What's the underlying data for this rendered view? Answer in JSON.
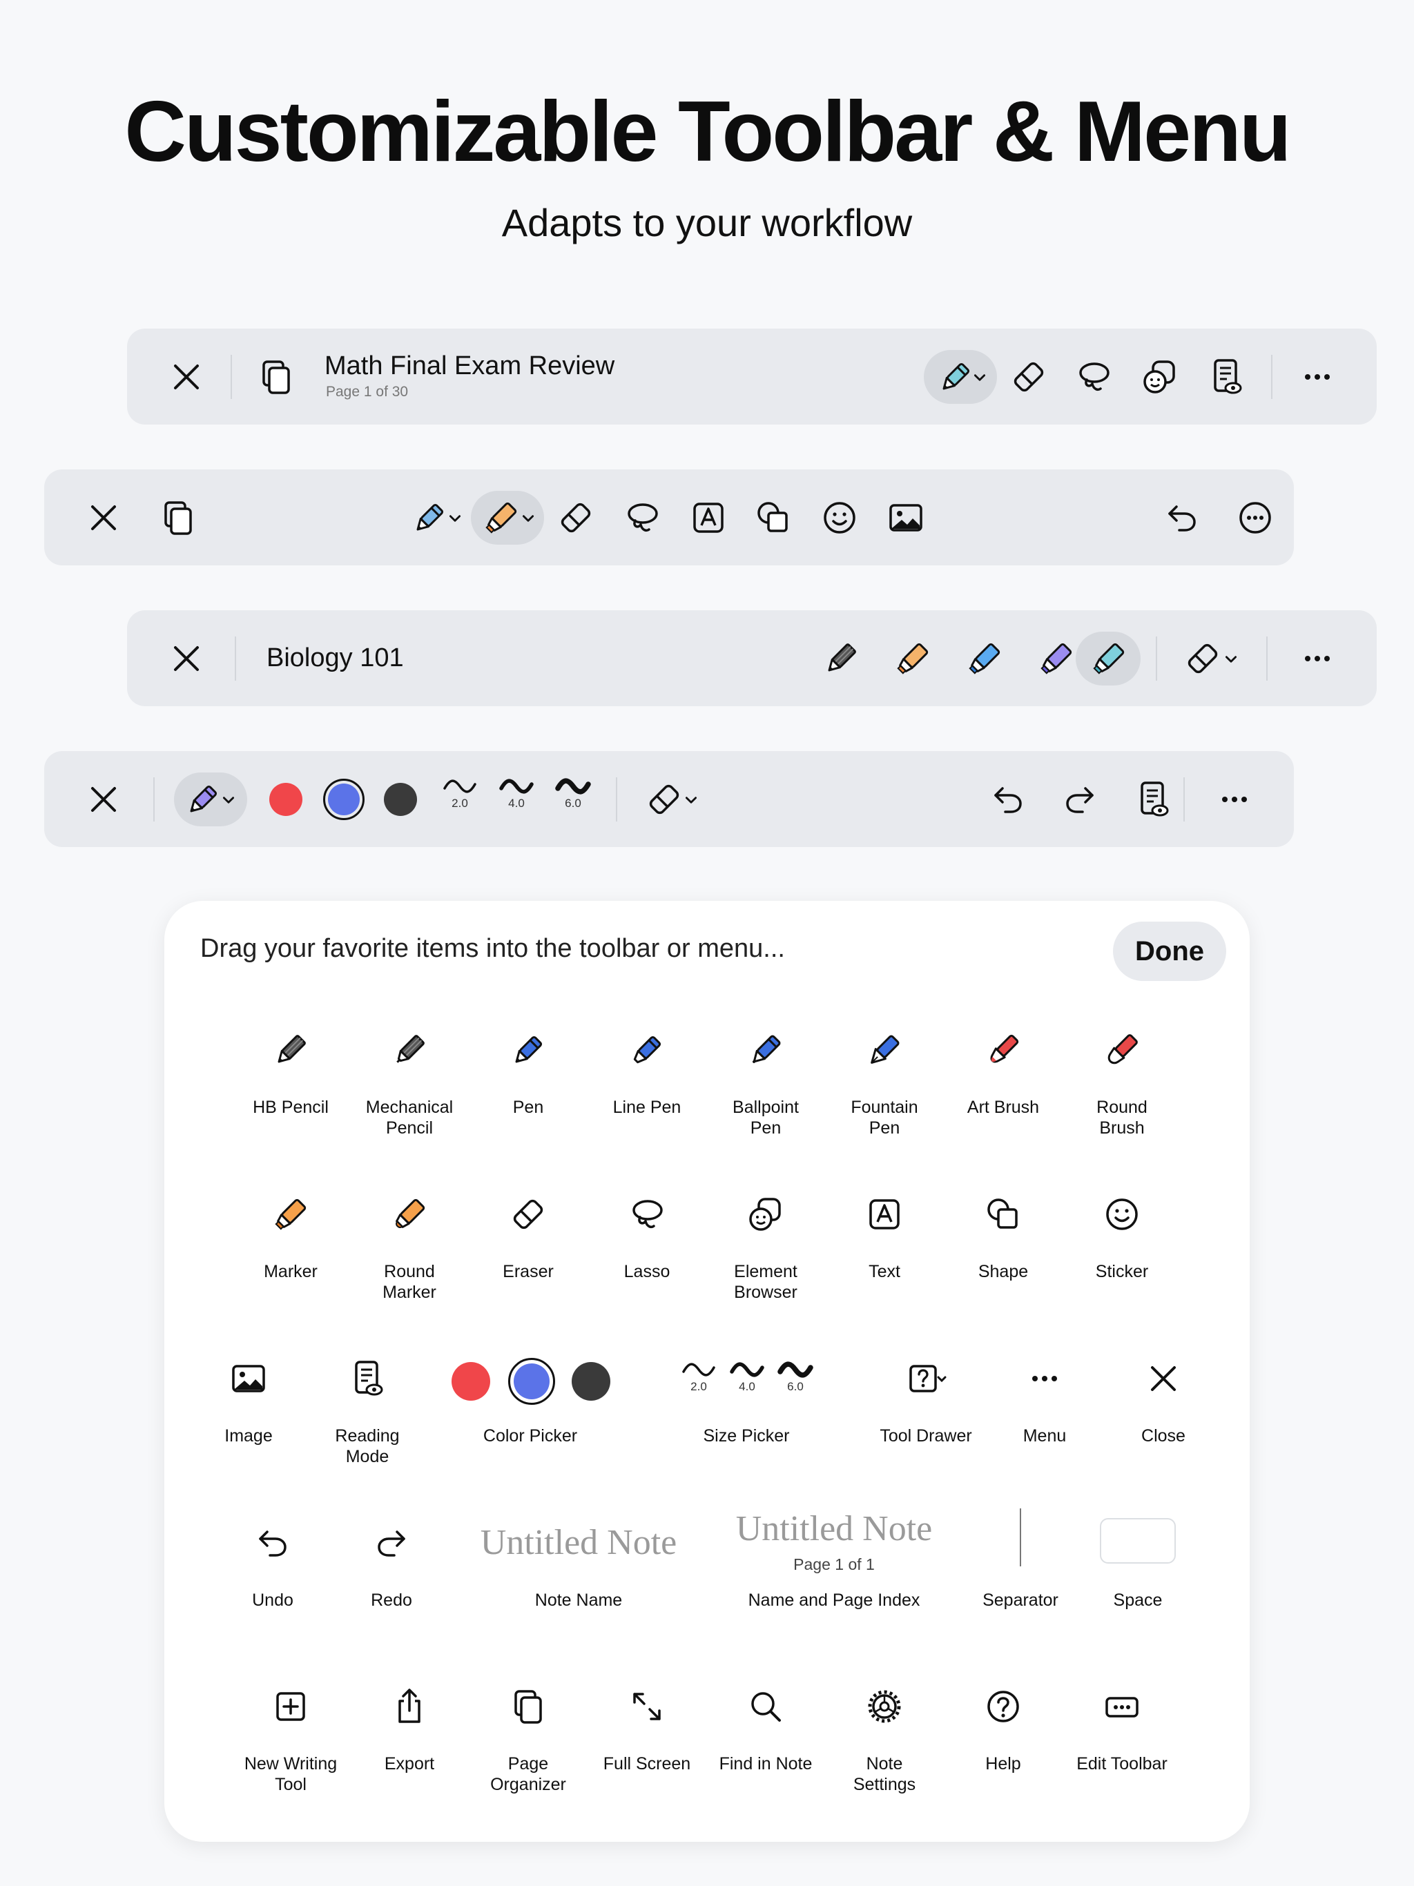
{
  "header": {
    "title": "Customizable Toolbar & Menu",
    "subtitle": "Adapts to your workflow"
  },
  "toolbar1": {
    "title": "Math Final Exam Review",
    "page_index": "Page 1 of 30"
  },
  "toolbar3": {
    "title": "Biology 101"
  },
  "toolbar4": {
    "colors": [
      "#f0464a",
      "#5b73e8",
      "#3a3a3a"
    ],
    "sizes": [
      "2.0",
      "4.0",
      "6.0"
    ]
  },
  "panel": {
    "hint": "Drag your favorite items into the toolbar or menu...",
    "done_label": "Done",
    "row1": [
      {
        "label": "HB Pencil",
        "icon": "pencil-dark-icon"
      },
      {
        "label": "Mechanical\nPencil",
        "icon": "mechanical-pencil-icon"
      },
      {
        "label": "Pen",
        "icon": "pen-icon"
      },
      {
        "label": "Line Pen",
        "icon": "line-pen-icon"
      },
      {
        "label": "Ballpoint\nPen",
        "icon": "ballpoint-pen-icon"
      },
      {
        "label": "Fountain\nPen",
        "icon": "fountain-pen-icon"
      },
      {
        "label": "Art Brush",
        "icon": "art-brush-icon"
      },
      {
        "label": "Round\nBrush",
        "icon": "round-brush-icon"
      }
    ],
    "row2": [
      {
        "label": "Marker",
        "icon": "marker-icon"
      },
      {
        "label": "Round\nMarker",
        "icon": "round-marker-icon"
      },
      {
        "label": "Eraser",
        "icon": "eraser-icon"
      },
      {
        "label": "Lasso",
        "icon": "lasso-icon"
      },
      {
        "label": "Element\nBrowser",
        "icon": "element-browser-icon"
      },
      {
        "label": "Text",
        "icon": "text-icon"
      },
      {
        "label": "Shape",
        "icon": "shape-icon"
      },
      {
        "label": "Sticker",
        "icon": "sticker-icon"
      }
    ],
    "row3": {
      "image": "Image",
      "reading_mode": "Reading\nMode",
      "color_picker": "Color Picker",
      "size_picker": "Size Picker",
      "tool_drawer": "Tool Drawer",
      "menu": "Menu",
      "close": "Close",
      "colors": [
        "#f0464a",
        "#5b73e8",
        "#3a3a3a"
      ],
      "sizes": [
        "2.0",
        "4.0",
        "6.0"
      ]
    },
    "row4": {
      "undo": "Undo",
      "redo": "Redo",
      "note_name_preview": "Untitled Note",
      "note_name": "Note Name",
      "name_index_preview": "Untitled Note",
      "name_index_page": "Page 1 of 1",
      "name_index": "Name and Page Index",
      "separator": "Separator",
      "space": "Space"
    },
    "row5": [
      {
        "label": "New Writing\nTool",
        "icon": "plus-square-icon"
      },
      {
        "label": "Export",
        "icon": "share-icon"
      },
      {
        "label": "Page\nOrganizer",
        "icon": "pages-icon"
      },
      {
        "label": "Full Screen",
        "icon": "expand-icon"
      },
      {
        "label": "Find in Note",
        "icon": "search-icon"
      },
      {
        "label": "Note\nSettings",
        "icon": "gear-icon"
      },
      {
        "label": "Help",
        "icon": "help-icon"
      },
      {
        "label": "Edit Toolbar",
        "icon": "edit-toolbar-icon"
      }
    ]
  }
}
